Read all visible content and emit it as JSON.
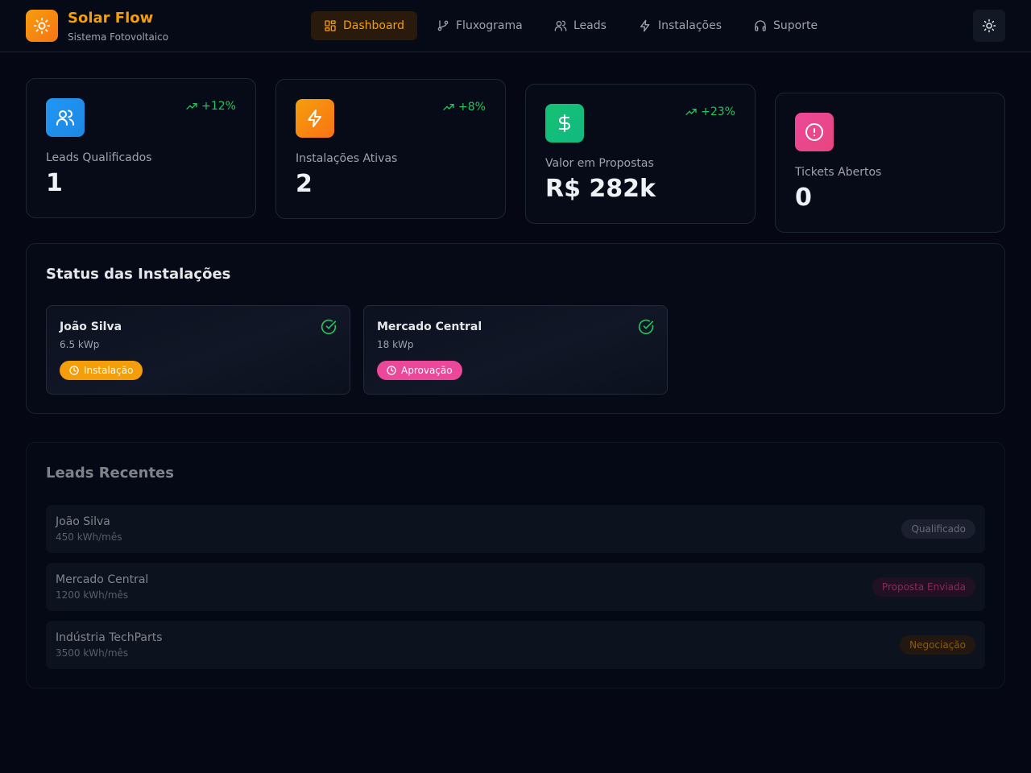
{
  "app": {
    "title": "Solar Flow",
    "subtitle": "Sistema Fotovoltaico",
    "logo_icon": "sun-icon"
  },
  "nav": [
    {
      "label": "Dashboard",
      "icon": "dashboard-icon",
      "active": true
    },
    {
      "label": "Fluxograma",
      "icon": "git-branch-icon",
      "active": false
    },
    {
      "label": "Leads",
      "icon": "users-icon",
      "active": false
    },
    {
      "label": "Instalações",
      "icon": "zap-icon",
      "active": false
    },
    {
      "label": "Suporte",
      "icon": "headphones-icon",
      "active": false
    }
  ],
  "theme_toggle": {
    "icon": "sun-icon"
  },
  "stats": [
    {
      "label": "Leads Qualificados",
      "value": "1",
      "trend": "+12%",
      "icon": "users-icon",
      "color": "#1e88e5"
    },
    {
      "label": "Instalações Ativas",
      "value": "2",
      "trend": "+8%",
      "icon": "zap-icon",
      "color": "#f59e0b"
    },
    {
      "label": "Valor em Propostas",
      "value": "R$ 282k",
      "trend": "+23%",
      "icon": "dollar-icon",
      "color": "#10b981"
    },
    {
      "label": "Tickets Abertos",
      "value": "0",
      "trend": "",
      "icon": "alert-circle-icon",
      "color": "#ec4899"
    }
  ],
  "status_section": {
    "title": "Status das Instalações",
    "items": [
      {
        "name": "João Silva",
        "power": "6.5 kWp",
        "stage": "Instalação",
        "stage_color": "#f59e0b"
      },
      {
        "name": "Mercado Central",
        "power": "18 kWp",
        "stage": "Aprovação",
        "stage_color": "#ec4899"
      }
    ]
  },
  "leads_section": {
    "title": "Leads Recentes",
    "items": [
      {
        "name": "João Silva",
        "usage": "450 kWh/mês",
        "status": "Qualificado"
      },
      {
        "name": "Mercado Central",
        "usage": "1200 kWh/mês",
        "status": "Proposta Enviada"
      },
      {
        "name": "Indústria TechParts",
        "usage": "3500 kWh/mês",
        "status": "Negociação"
      }
    ]
  }
}
